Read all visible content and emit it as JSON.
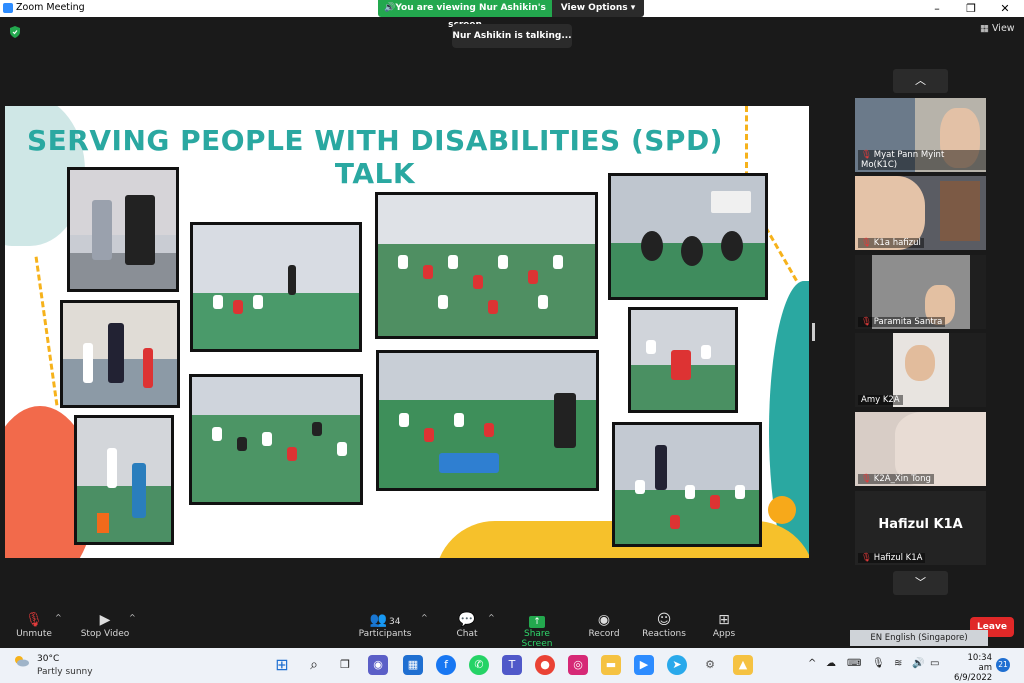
{
  "window": {
    "title": "Zoom Meeting",
    "minimize": "–",
    "maximize": "❐",
    "close": "✕"
  },
  "share_banner": {
    "text": "You are viewing Nur Ashikin's screen",
    "view_options": "View Options"
  },
  "talking_indicator": "Nur Ashikin is talking...",
  "view_button": "View",
  "slide": {
    "title": "SERVING PEOPLE WITH DISABILITIES (SPD) TALK",
    "colors": {
      "title": "#2aa8a1",
      "accent_yellow": "#f6c12b",
      "accent_red": "#f26a4b",
      "accent_teal": "#2aa8a1"
    }
  },
  "participants_panel": {
    "up_arrow": "︿",
    "down_arrow": "﹀",
    "tiles": [
      {
        "name": "Myat Pann Myint Mo(K1C)",
        "muted": true
      },
      {
        "name": "K1a hafizul",
        "muted": true
      },
      {
        "name": "Paramita Santra",
        "muted": true
      },
      {
        "name": "Amy K2A",
        "muted": false
      },
      {
        "name": "K2A_Xin Tong",
        "muted": true
      },
      {
        "name": "Hafizul K1A",
        "muted": true,
        "avatar_text": "Hafizul K1A"
      }
    ]
  },
  "toolbar": {
    "unmute": "Unmute",
    "stop_video": "Stop Video",
    "participants": "Participants",
    "participant_count": "34",
    "chat": "Chat",
    "share_screen": "Share Screen",
    "record": "Record",
    "reactions": "Reactions",
    "apps": "Apps",
    "leave": "Leave",
    "language": "EN English (Singapore)"
  },
  "taskbar": {
    "temperature": "30°C",
    "weather": "Partly sunny",
    "time": "10:34 am",
    "date": "6/9/2022",
    "notifications": "21"
  }
}
